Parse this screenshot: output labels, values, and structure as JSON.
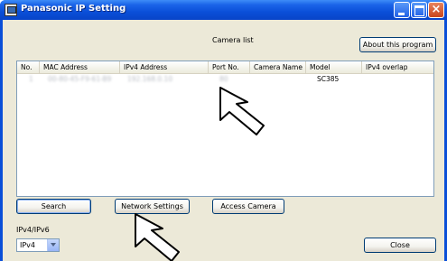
{
  "window": {
    "title": "Panasonic IP Setting",
    "close_glyph": "×"
  },
  "caption": "Camera list",
  "buttons": {
    "about": "About this program",
    "search": "Search",
    "network_settings": "Network Settings",
    "access_camera": "Access Camera",
    "close": "Close"
  },
  "list": {
    "columns": [
      "No.",
      "MAC Address",
      "IPv4 Address",
      "Port No.",
      "Camera Name",
      "Model",
      "IPv4 overlap"
    ],
    "rows": [
      {
        "no": "1",
        "mac": "00-80-45-F9-61-B9",
        "ipv4": "192.168.0.10",
        "port": "80",
        "camera_name": "",
        "model": "SC385",
        "overlap": ""
      }
    ]
  },
  "ip_mode": {
    "label": "IPv4/IPv6",
    "selected": "IPv4"
  },
  "icons": {
    "app": "panasonic-app-icon",
    "cursors": [
      "arrow-cursor-pointing-at-port",
      "arrow-cursor-pointing-at-network-settings"
    ]
  },
  "colors": {
    "titlebar": "#0a4fd8",
    "client_bg": "#ece9d8",
    "list_border": "#7f9db9"
  }
}
